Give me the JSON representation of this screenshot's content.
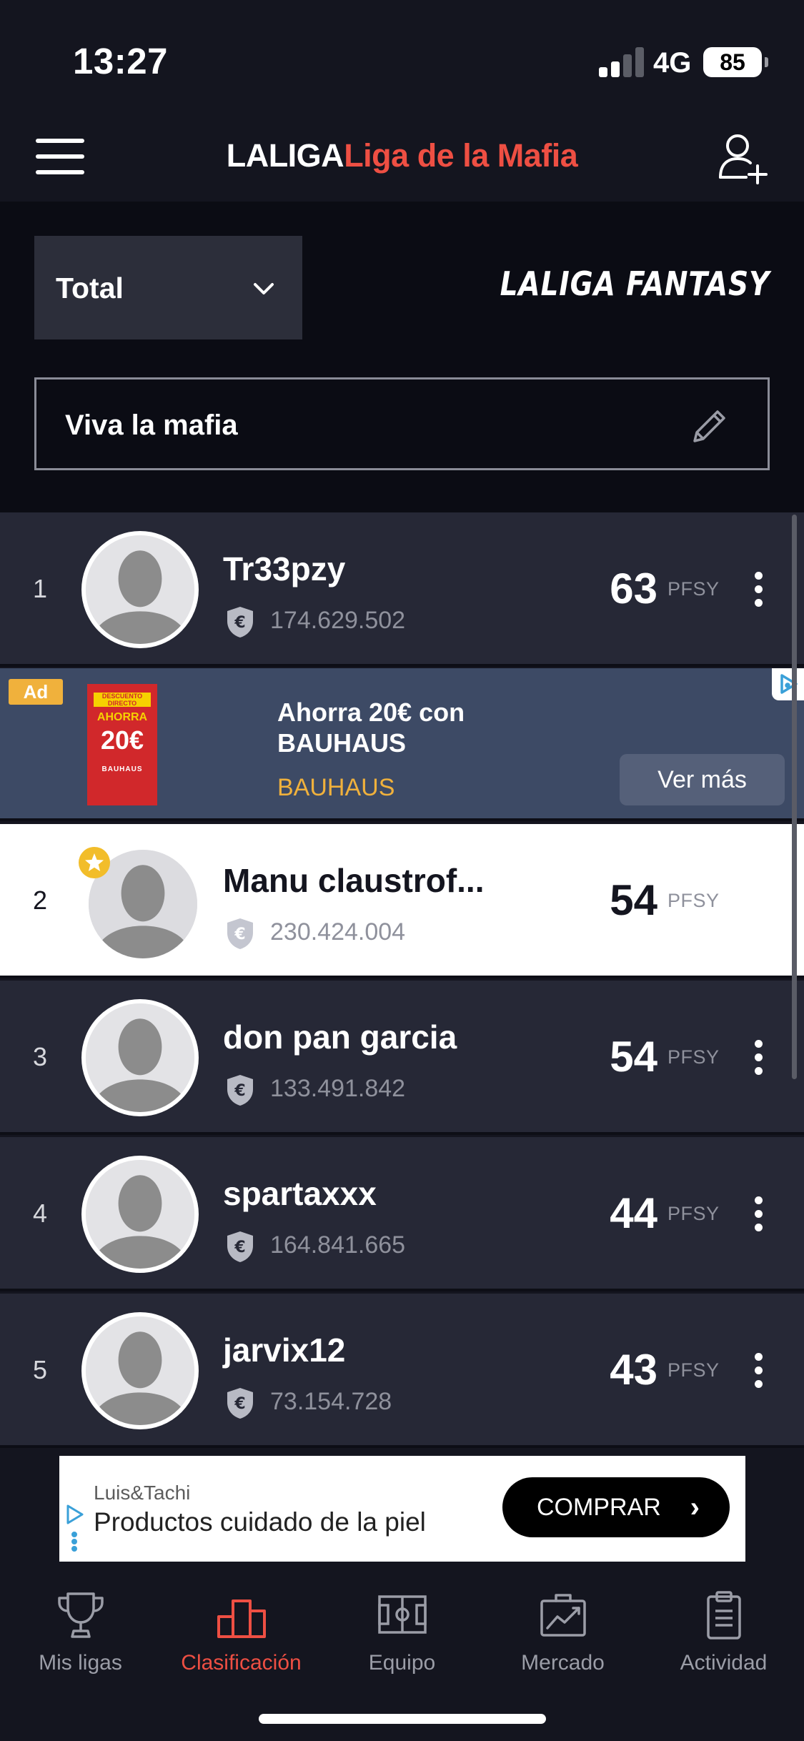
{
  "status_bar": {
    "time": "13:27",
    "network": "4G",
    "battery": "85"
  },
  "header": {
    "brand_prefix": "LALIGA",
    "league_title": "Liga de la Mafia"
  },
  "filter": {
    "selected": "Total"
  },
  "fantasy_logo": "LALIGA FANTASY",
  "league_name": "Viva la mafia",
  "ranking": [
    {
      "position": "1",
      "name": "Tr33pzy",
      "value": "174.629.502",
      "points": "63",
      "unit": "PFSY",
      "is_me": false
    },
    {
      "position": "2",
      "name": "Manu claustrof...",
      "value": "230.424.004",
      "points": "54",
      "unit": "PFSY",
      "is_me": true
    },
    {
      "position": "3",
      "name": "don pan garcia",
      "value": "133.491.842",
      "points": "54",
      "unit": "PFSY",
      "is_me": false
    },
    {
      "position": "4",
      "name": "spartaxxx",
      "value": "164.841.665",
      "points": "44",
      "unit": "PFSY",
      "is_me": false
    },
    {
      "position": "5",
      "name": "jarvix12",
      "value": "73.154.728",
      "points": "43",
      "unit": "PFSY",
      "is_me": false
    }
  ],
  "ad_inline": {
    "badge": "Ad",
    "title": "Ahorra 20€ con BAUHAUS",
    "advertiser": "BAUHAUS",
    "cta": "Ver más",
    "image_text": {
      "top": "DESCUENTO DIRECTO",
      "ahorra": "AHORRA",
      "amount": "20€",
      "brand": "BAUHAUS"
    }
  },
  "ad_banner": {
    "advertiser": "Luis&Tachi",
    "title": "Productos cuidado de la piel",
    "cta": "COMPRAR"
  },
  "tabs": [
    {
      "label": "Mis ligas",
      "icon": "trophy-icon",
      "active": false
    },
    {
      "label": "Clasificación",
      "icon": "podium-icon",
      "active": true
    },
    {
      "label": "Equipo",
      "icon": "pitch-icon",
      "active": false
    },
    {
      "label": "Mercado",
      "icon": "market-icon",
      "active": false
    },
    {
      "label": "Actividad",
      "icon": "clipboard-icon",
      "active": false
    }
  ],
  "colors": {
    "accent": "#ee4f43",
    "background": "#14151f",
    "row": "#262836",
    "ad_gold": "#f0b13c"
  }
}
